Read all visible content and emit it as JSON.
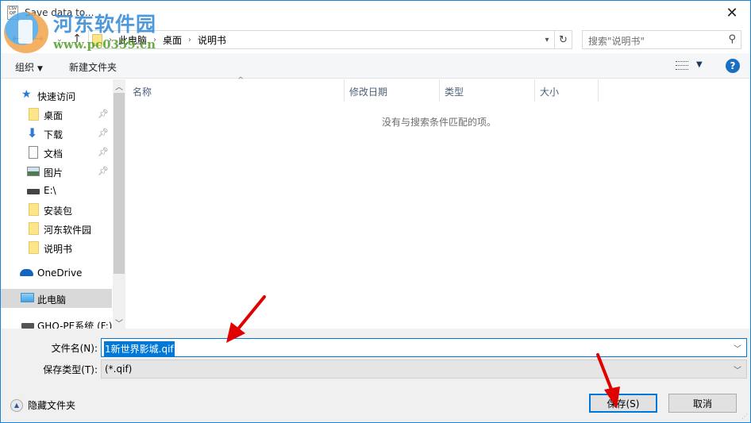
{
  "window": {
    "title": "Save data to...",
    "app_icon_text": "CSV\nQIF",
    "close_icon": "close-icon"
  },
  "watermark": {
    "title": "河东软件园",
    "url": "www.pc0359.cn"
  },
  "navigation": {
    "back_icon": "back-arrow-icon",
    "forward_icon": "forward-arrow-icon",
    "recent_icon": "chevron-down-icon",
    "up_icon": "up-arrow-icon",
    "breadcrumb": [
      "此电脑",
      "桌面",
      "说明书"
    ],
    "refresh_icon": "refresh-icon",
    "search_placeholder": "搜索\"说明书\"",
    "search_icon": "search-icon"
  },
  "toolbar": {
    "organize_label": "组织",
    "new_folder_label": "新建文件夹",
    "view_icon": "view-details-icon",
    "help_icon": "help-icon"
  },
  "sidebar": {
    "items": [
      {
        "label": "快速访问",
        "icon": "star-icon",
        "pinned": false
      },
      {
        "label": "桌面",
        "icon": "folder-icon",
        "pinned": true
      },
      {
        "label": "下载",
        "icon": "download-icon",
        "pinned": true
      },
      {
        "label": "文档",
        "icon": "document-icon",
        "pinned": true
      },
      {
        "label": "图片",
        "icon": "pictures-icon",
        "pinned": true
      },
      {
        "label": "E:\\",
        "icon": "drive-icon",
        "pinned": false
      },
      {
        "label": "安装包",
        "icon": "folder-icon",
        "pinned": false
      },
      {
        "label": "河东软件园",
        "icon": "folder-icon",
        "pinned": false
      },
      {
        "label": "说明书",
        "icon": "folder-icon",
        "pinned": false
      },
      {
        "label": "OneDrive",
        "icon": "cloud-icon",
        "pinned": false
      },
      {
        "label": "此电脑",
        "icon": "computer-icon",
        "pinned": false,
        "selected": true
      },
      {
        "label": "GHO-PE系统 (F:)",
        "icon": "drive-icon",
        "pinned": false
      }
    ]
  },
  "filelist": {
    "columns": [
      "名称",
      "修改日期",
      "类型",
      "大小"
    ],
    "empty_message": "没有与搜索条件匹配的项。"
  },
  "form": {
    "filename_label": "文件名(N):",
    "filename_value": "1新世界影城.qif",
    "filetype_label": "保存类型(T):",
    "filetype_value": "(*.qif)",
    "hide_folders_label": "隐藏文件夹",
    "save_label": "保存(S)",
    "cancel_label": "取消"
  },
  "colors": {
    "accent": "#0078d7",
    "window_border": "#1883d7",
    "annotation_arrow": "#e00000"
  }
}
